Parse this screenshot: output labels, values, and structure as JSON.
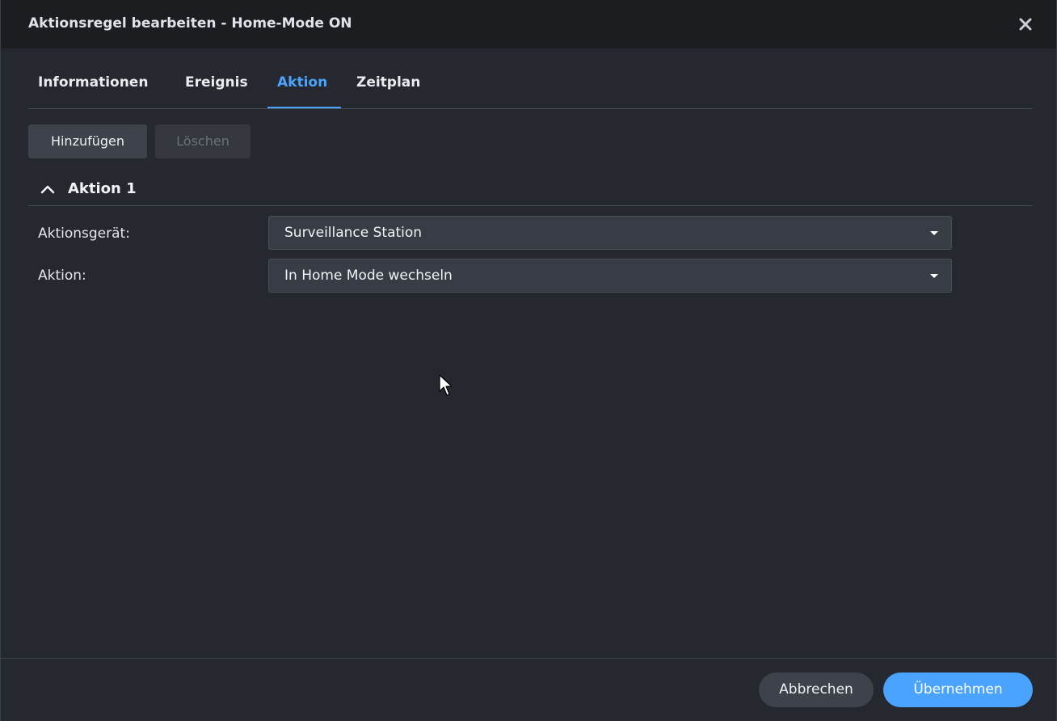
{
  "window": {
    "title": "Aktionsregel bearbeiten - Home-Mode ON",
    "close_icon": "close-icon"
  },
  "tabs": [
    {
      "label": "Informationen",
      "active": false
    },
    {
      "label": "Ereignis",
      "active": false
    },
    {
      "label": "Aktion",
      "active": true
    },
    {
      "label": "Zeitplan",
      "active": false
    }
  ],
  "toolbar": {
    "add_label": "Hinzufügen",
    "delete_label": "Löschen",
    "delete_enabled": false
  },
  "section": {
    "title": "Aktion 1",
    "expanded": true,
    "chevron_icon": "chevron-up-icon"
  },
  "fields": [
    {
      "label": "Aktionsgerät:",
      "value": "Surveillance Station"
    },
    {
      "label": "Aktion:",
      "value": "In Home Mode wechseln"
    }
  ],
  "footer": {
    "cancel_label": "Abbrechen",
    "apply_label": "Übernehmen"
  },
  "colors": {
    "accent": "#4aa3ff",
    "background": "#25282e",
    "titlebar": "#1b1d21"
  }
}
